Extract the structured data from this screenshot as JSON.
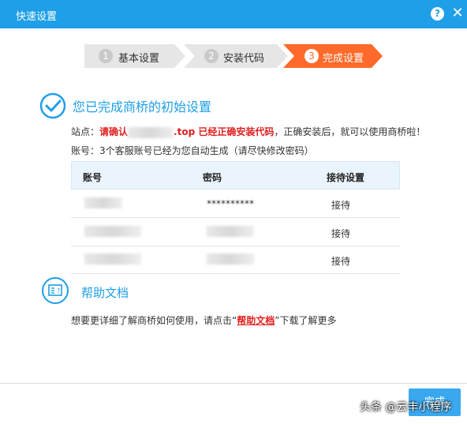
{
  "window": {
    "title": "快速设置",
    "help_label": "?",
    "close_label": "✕"
  },
  "steps": [
    {
      "number": "1",
      "label": "基本设置",
      "state": "done"
    },
    {
      "number": "2",
      "label": "安装代码",
      "state": "done"
    },
    {
      "number": "3",
      "label": "完成设置",
      "state": "active"
    }
  ],
  "completion": {
    "title": "您已完成商桥的初始设置"
  },
  "site": {
    "prefix": "站点：",
    "confirm_text": "请确认",
    "domain_suffix": ".top",
    "installed_text": " 已经正确安装代码",
    "rest": "，正确安装后，就可以使用商桥啦！"
  },
  "account_note": "账号：3个客服账号已经为您自动生成（请尽快修改密码）",
  "table": {
    "headers": [
      "账号",
      "密码",
      "接待设置"
    ],
    "rows": [
      {
        "password": "**********",
        "action": "接待"
      },
      {
        "password": "",
        "action": "接待"
      },
      {
        "password": "",
        "action": "接待"
      }
    ]
  },
  "help": {
    "title": "帮助文档",
    "text_before": "想要更详细了解商桥如何使用，请点击“",
    "link": "帮助文档",
    "text_after": "”下载了解更多"
  },
  "footer": {
    "finish_label": "完成"
  },
  "watermark": "头条 @云丰小程序",
  "colors": {
    "titlebar": "#1e9fe8",
    "active_step": "#ff6a2b",
    "done_step": "#e6e6e6",
    "accent": "#1e9fe8",
    "warning": "#e02020"
  }
}
